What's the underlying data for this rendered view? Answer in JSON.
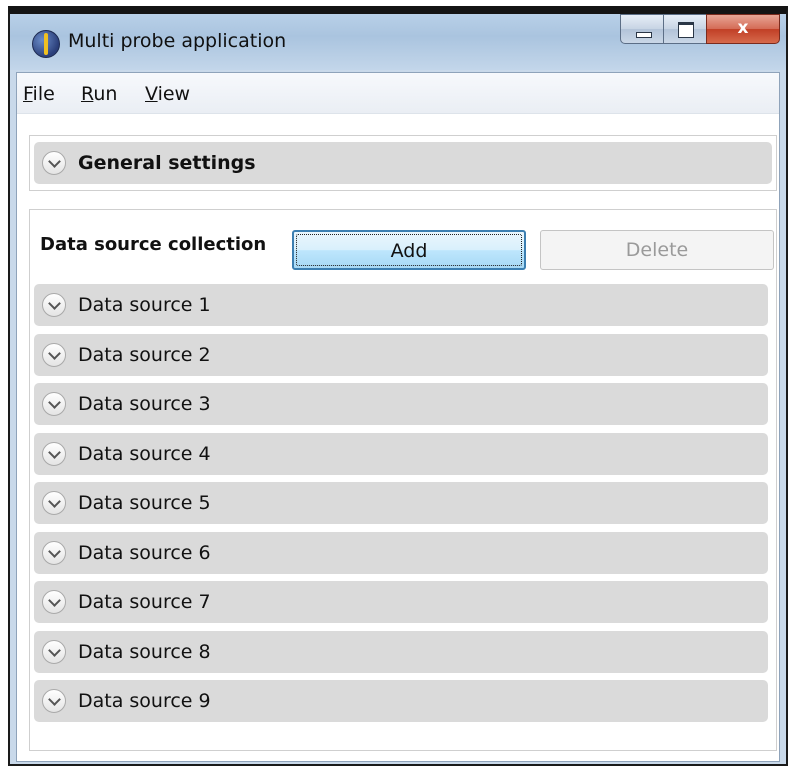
{
  "window": {
    "title": "Multi probe application",
    "controls": {
      "minimize": "minimize",
      "maximize": "maximize",
      "close": "x"
    }
  },
  "menu": {
    "items": [
      {
        "label": "File",
        "mnemonic": "F"
      },
      {
        "label": "Run",
        "mnemonic": "R"
      },
      {
        "label": "View",
        "mnemonic": "V"
      }
    ]
  },
  "general_settings": {
    "label": "General settings",
    "expanded": false
  },
  "data_source_collection": {
    "label": "Data source collection",
    "add_label": "Add",
    "delete_label": "Delete",
    "delete_enabled": false,
    "items": [
      {
        "label": "Data source 1"
      },
      {
        "label": "Data source 2"
      },
      {
        "label": "Data source 3"
      },
      {
        "label": "Data source 4"
      },
      {
        "label": "Data source 5"
      },
      {
        "label": "Data source 6"
      },
      {
        "label": "Data source 7"
      },
      {
        "label": "Data source 8"
      },
      {
        "label": "Data source 9"
      }
    ]
  },
  "icons": {
    "app": "probe-app-icon",
    "expander": "chevron-down-icon"
  }
}
